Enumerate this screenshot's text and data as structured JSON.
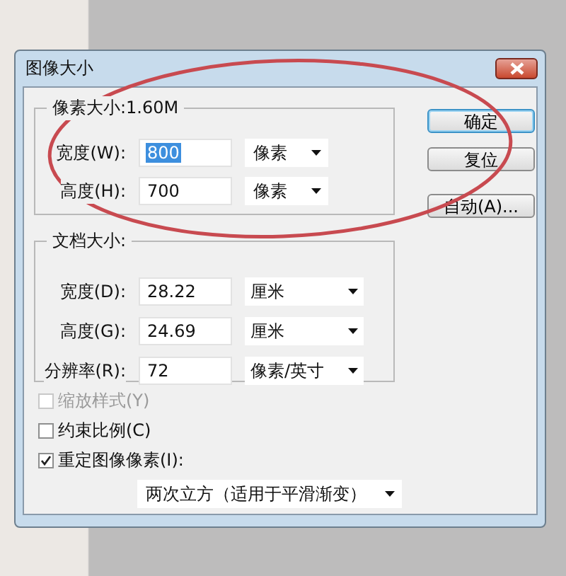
{
  "window": {
    "title": "图像大小"
  },
  "pixel_dimensions": {
    "title": "像素大小:1.60M",
    "rows": [
      {
        "label": "宽度(W):",
        "value": "800",
        "text_selected": true,
        "unit": "像素"
      },
      {
        "label": "高度(H):",
        "value": "700",
        "text_selected": false,
        "unit": "像素"
      }
    ]
  },
  "document_size": {
    "title": "文档大小:",
    "rows": [
      {
        "label": "宽度(D):",
        "value": "28.22",
        "text_selected": false,
        "unit": "厘米"
      },
      {
        "label": "高度(G):",
        "value": "24.69",
        "text_selected": false,
        "unit": "厘米"
      },
      {
        "label": "分辨率(R):",
        "value": "72",
        "text_selected": false,
        "unit": "像素/英寸"
      }
    ]
  },
  "buttons": [
    {
      "label": "确定",
      "default": true
    },
    {
      "label": "复位",
      "default": false
    },
    {
      "label": "自动(A)...",
      "default": false
    }
  ],
  "options": [
    {
      "label": "缩放样式(Y)",
      "checked": false,
      "disabled": true
    },
    {
      "label": "约束比例(C)",
      "checked": false,
      "disabled": false
    },
    {
      "label": "重定图像像素(I):",
      "checked": true,
      "disabled": false
    }
  ],
  "resample": {
    "value": "两次立方（适用于平滑渐变）"
  },
  "annotation": {
    "kind": "ellipse"
  }
}
